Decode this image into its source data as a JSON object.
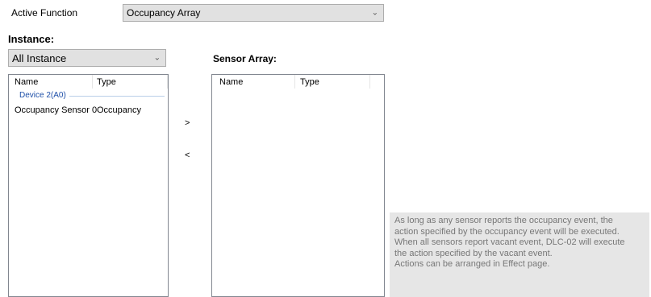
{
  "active_function": {
    "label": "Active Function",
    "selected": "Occupancy Array"
  },
  "instance": {
    "heading": "Instance:",
    "filter_selected": "All Instance",
    "columns": [
      "Name",
      "Type"
    ],
    "group": "Device 2(A0)",
    "rows": [
      {
        "name": "Occupancy Sensor 0",
        "type": "Occupancy"
      }
    ]
  },
  "transfer": {
    "add_label": ">",
    "remove_label": "<"
  },
  "sensor_array": {
    "heading": "Sensor Array:",
    "columns": [
      "Name",
      "Type"
    ]
  },
  "note": {
    "lines": [
      "As long as any sensor reports the occupancy event, the",
      "action specified by the occupancy event will be executed.",
      "When all sensors report vacant event, DLC-02 will execute",
      "the action specified by the vacant event.",
      "Actions can be arranged in Effect page."
    ]
  },
  "icons": {
    "dropdown": "chevron-down-icon"
  }
}
